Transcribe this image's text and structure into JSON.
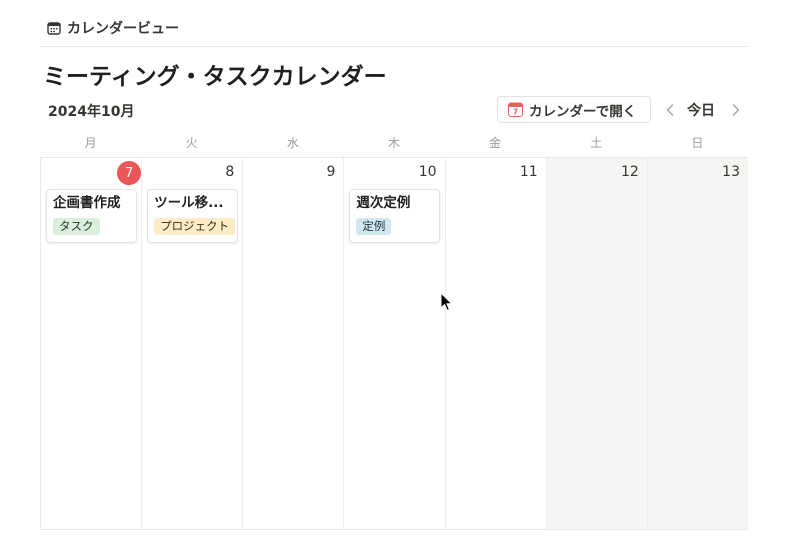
{
  "view_tab": {
    "label": "カレンダービュー",
    "icon": "calendar-icon"
  },
  "page_title": "ミーティング・タスクカレンダー",
  "toolbar": {
    "month_label": "2024年10月",
    "open_calendar_label": "カレンダーで開く",
    "open_calendar_icon_day": "7",
    "today_label": "今日"
  },
  "weekdays": [
    "月",
    "火",
    "水",
    "木",
    "金",
    "土",
    "日"
  ],
  "days": [
    {
      "num": "7",
      "today": true
    },
    {
      "num": "8"
    },
    {
      "num": "9"
    },
    {
      "num": "10"
    },
    {
      "num": "11"
    },
    {
      "num": "12",
      "weekend": true
    },
    {
      "num": "13",
      "weekend": true
    }
  ],
  "events": [
    {
      "day_index": 0,
      "title": "企画書作成",
      "tag": "タスク",
      "tag_bg": "#dbeddb",
      "tag_color": "#1c3829"
    },
    {
      "day_index": 1,
      "title": "ツール移...",
      "tag": "プロジェクト",
      "tag_bg": "#fdecc8",
      "tag_color": "#402c1b"
    },
    {
      "day_index": 3,
      "title": "週次定例",
      "tag": "定例",
      "tag_bg": "#d3e5ef",
      "tag_color": "#183347"
    }
  ],
  "colors": {
    "today_accent": "#eb5757",
    "weekend_bg": "#f5f5f3",
    "calendar_icon_red": "#e16259"
  }
}
